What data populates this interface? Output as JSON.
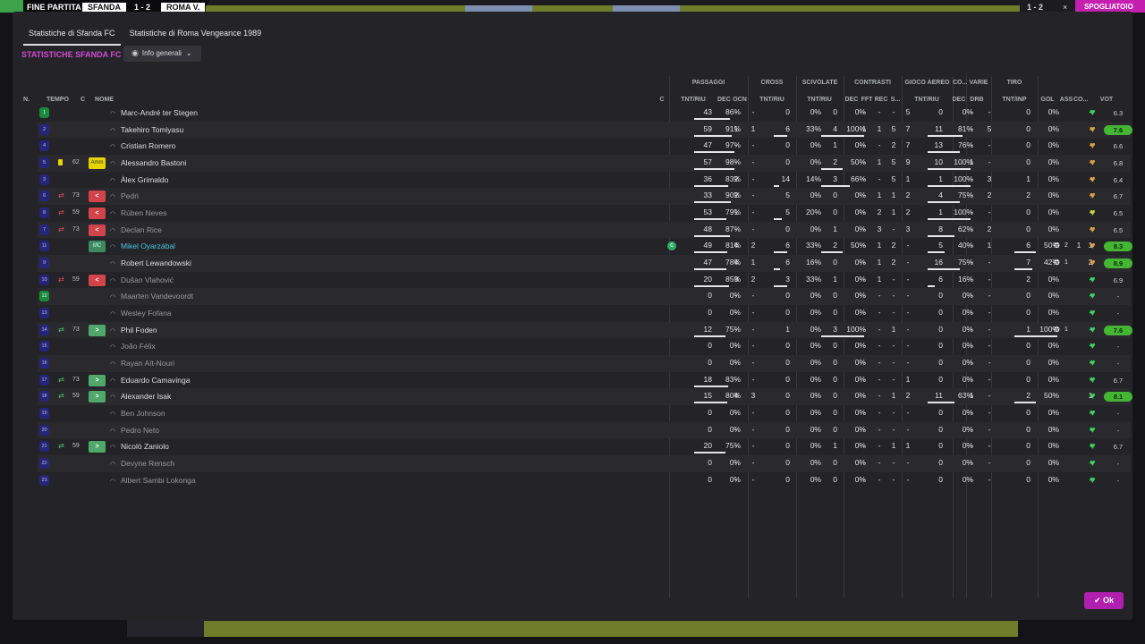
{
  "topbar": {
    "left_label": "FINE PARTITA",
    "home_team": "SFANDA",
    "score": "1 - 2",
    "away_team": "ROMA V.",
    "right_score": "1 - 2",
    "close": "×",
    "action": "SPOGLIATOIO"
  },
  "tabs": [
    {
      "label": "Statistiche di Sfanda FC",
      "active": true
    },
    {
      "label": "Statistiche di Roma Vengeance 1989",
      "active": false
    }
  ],
  "section_title": "STATISTICHE SFANDA FC",
  "filter": {
    "icon": "eye-icon",
    "label": "Info generali"
  },
  "groups": [
    "PASSAGGI",
    "CROSS",
    "SCIVOLATE",
    "CONTRASTI",
    "GIOCO AEREO",
    "CO...",
    "VARIE",
    "TIRO"
  ],
  "columns": {
    "num": "N.",
    "time": "TEMPO",
    "role": "C",
    "name": "NOME",
    "cond": "C",
    "pass_tr": "TNT/RIU",
    "pass_dec": "DEC",
    "pass_ocn": "OCN",
    "cross_tr": "TNT/RIU",
    "tack_tr": "TNT/RIU",
    "con_dec": "DEC",
    "con_fft": "FFT",
    "con_rec": "REC",
    "con_s": "S...",
    "air_tr": "TNT/RIU",
    "co_dec": "DEC",
    "var_drb": "DRB",
    "shot_tr": "TNT/INP",
    "gol": "GOL",
    "ass": "ASS",
    "co2": "CO...",
    "vote": "VOT"
  },
  "players": [
    {
      "num": "1",
      "gk": true,
      "time": "",
      "sub": "",
      "card": "",
      "role_box": "",
      "name": "Marc-André ter Stegen",
      "dim": false,
      "hl": false,
      "icon": "",
      "p": [
        "43",
        "86%",
        0.86
      ],
      "pd": "-",
      "po": "-",
      "c": [
        "0",
        "0%",
        0
      ],
      "s": [
        "0",
        "0%",
        0
      ],
      "cd": "-",
      "cf": "-",
      "cr": "-",
      "cs": "5",
      "a": [
        "0",
        "0%",
        0
      ],
      "kd": "-",
      "dr": "-",
      "t": [
        "0",
        "0%",
        0
      ],
      "gol": "",
      "gi": "",
      "ass": "-",
      "heart": "g",
      "vote": "6.3",
      "vhi": false
    },
    {
      "num": "2",
      "gk": false,
      "time": "",
      "sub": "",
      "card": "",
      "role_box": "",
      "name": "Takehiro Tomiyasu",
      "dim": false,
      "hl": false,
      "icon": "",
      "p": [
        "59",
        "91%",
        0.91
      ],
      "pd": "1",
      "po": "1",
      "c": [
        "6",
        "33%",
        0.33
      ],
      "s": [
        "4",
        "100%",
        1
      ],
      "cd": "1",
      "cf": "1",
      "cr": "5",
      "cs": "7",
      "a": [
        "11",
        "81%",
        0.81
      ],
      "kd": "-",
      "dr": "5",
      "t": [
        "0",
        "0%",
        0
      ],
      "gol": "",
      "gi": "",
      "ass": "-",
      "heart": "o",
      "vote": "7.6",
      "vhi": true
    },
    {
      "num": "4",
      "gk": false,
      "time": "",
      "sub": "",
      "card": "",
      "role_box": "",
      "name": "Cristian Romero",
      "dim": false,
      "hl": false,
      "icon": "",
      "p": [
        "47",
        "97%",
        0.97
      ],
      "pd": "-",
      "po": "-",
      "c": [
        "0",
        "0%",
        0
      ],
      "s": [
        "1",
        "0%",
        0
      ],
      "cd": "-",
      "cf": "-",
      "cr": "2",
      "cs": "7",
      "a": [
        "13",
        "76%",
        0.76
      ],
      "kd": "-",
      "dr": "-",
      "t": [
        "0",
        "0%",
        0
      ],
      "gol": "",
      "gi": "",
      "ass": "-",
      "heart": "o",
      "vote": "6.6",
      "vhi": false
    },
    {
      "num": "5",
      "gk": false,
      "time": "62",
      "sub": "yellow",
      "card": "Amm",
      "role_box": "cap",
      "name": "Alessandro Bastoni",
      "dim": false,
      "hl": false,
      "icon": "",
      "p": [
        "57",
        "98%",
        0.98
      ],
      "pd": "-",
      "po": "-",
      "c": [
        "0",
        "0%",
        0
      ],
      "s": [
        "2",
        "50%",
        0.5
      ],
      "cd": "-",
      "cf": "1",
      "cr": "5",
      "cs": "9",
      "a": [
        "10",
        "100%",
        1
      ],
      "kd": "1",
      "dr": "-",
      "t": [
        "0",
        "0%",
        0
      ],
      "gol": "",
      "gi": "",
      "ass": "-",
      "heart": "o",
      "vote": "6.8",
      "vhi": false
    },
    {
      "num": "3",
      "gk": false,
      "time": "",
      "sub": "",
      "card": "",
      "role_box": "",
      "name": "Àlex Grimaldo",
      "dim": false,
      "hl": false,
      "icon": "",
      "p": [
        "36",
        "83%",
        0.83
      ],
      "pd": "2",
      "po": "-",
      "c": [
        "14",
        "14%",
        0.14
      ],
      "s": [
        "3",
        "66%",
        0.66
      ],
      "cd": "-",
      "cf": "-",
      "cr": "5",
      "cs": "1",
      "a": [
        "1",
        "100%",
        1
      ],
      "kd": "-",
      "dr": "3",
      "t": [
        "1",
        "0%",
        0
      ],
      "gol": "",
      "gi": "",
      "ass": "-",
      "heart": "o",
      "vote": "6.4",
      "vhi": false
    },
    {
      "num": "6",
      "gk": false,
      "time": "73",
      "sub": "out",
      "card": "<",
      "role_box": "out",
      "name": "Pedri",
      "dim": true,
      "hl": false,
      "icon": "",
      "p": [
        "33",
        "90%",
        0.9
      ],
      "pd": "2",
      "po": "-",
      "c": [
        "5",
        "0%",
        0
      ],
      "s": [
        "0",
        "0%",
        0
      ],
      "cd": "-",
      "cf": "1",
      "cr": "1",
      "cs": "2",
      "a": [
        "4",
        "75%",
        0.75
      ],
      "kd": "-",
      "dr": "2",
      "t": [
        "2",
        "0%",
        0
      ],
      "gol": "",
      "gi": "",
      "ass": "-",
      "heart": "o",
      "vote": "6.7",
      "vhi": false
    },
    {
      "num": "8",
      "gk": false,
      "time": "59",
      "sub": "out",
      "card": "<",
      "role_box": "out",
      "name": "Rúben Neves",
      "dim": true,
      "hl": false,
      "icon": "",
      "p": [
        "53",
        "79%",
        0.79
      ],
      "pd": "1",
      "po": "-",
      "c": [
        "5",
        "20%",
        0.2
      ],
      "s": [
        "0",
        "0%",
        0
      ],
      "cd": "-",
      "cf": "2",
      "cr": "1",
      "cs": "2",
      "a": [
        "1",
        "100%",
        1
      ],
      "kd": "-",
      "dr": "-",
      "t": [
        "0",
        "0%",
        0
      ],
      "gol": "",
      "gi": "",
      "ass": "-",
      "heart": "y",
      "vote": "6.5",
      "vhi": false
    },
    {
      "num": "7",
      "gk": false,
      "time": "73",
      "sub": "out",
      "card": "<",
      "role_box": "out",
      "name": "Declan Rice",
      "dim": true,
      "hl": false,
      "icon": "",
      "p": [
        "48",
        "87%",
        0.87
      ],
      "pd": "-",
      "po": "-",
      "c": [
        "0",
        "0%",
        0
      ],
      "s": [
        "1",
        "0%",
        0
      ],
      "cd": "-",
      "cf": "3",
      "cr": "-",
      "cs": "3",
      "a": [
        "8",
        "62%",
        0.62
      ],
      "kd": "-",
      "dr": "2",
      "t": [
        "0",
        "0%",
        0
      ],
      "gol": "",
      "gi": "",
      "ass": "-",
      "heart": "o",
      "vote": "6.5",
      "vhi": false
    },
    {
      "num": "11",
      "gk": false,
      "time": "",
      "sub": "",
      "card": "MC",
      "role_box": "mc",
      "name": "Mikel Oyarzábal",
      "dim": false,
      "hl": true,
      "icon": "c",
      "p": [
        "49",
        "81%",
        0.81
      ],
      "pd": "4",
      "po": "2",
      "c": [
        "6",
        "33%",
        0.33
      ],
      "s": [
        "2",
        "50%",
        0.5
      ],
      "cd": "-",
      "cf": "1",
      "cr": "2",
      "cs": "-",
      "a": [
        "5",
        "40%",
        0.4
      ],
      "kd": "-",
      "dr": "1",
      "t": [
        "6",
        "50%",
        0.5
      ],
      "gol": "1",
      "gi": "2",
      "ass": "1",
      "heart": "o",
      "vote": "8.3",
      "vhi": true
    },
    {
      "num": "9",
      "gk": false,
      "time": "",
      "sub": "",
      "card": "",
      "role_box": "",
      "name": "Robert Lewandowski",
      "dim": false,
      "hl": false,
      "icon": "",
      "p": [
        "47",
        "78%",
        0.78
      ],
      "pd": "4",
      "po": "1",
      "c": [
        "6",
        "16%",
        0.16
      ],
      "s": [
        "0",
        "0%",
        0
      ],
      "cd": "-",
      "cf": "1",
      "cr": "2",
      "cs": "-",
      "a": [
        "16",
        "75%",
        0.75
      ],
      "kd": "-",
      "dr": "-",
      "t": [
        "7",
        "42%",
        0.42
      ],
      "gol": "",
      "gi": "1",
      "ass": "2",
      "heart": "o",
      "vote": "8.9",
      "vhi": true
    },
    {
      "num": "10",
      "gk": false,
      "time": "59",
      "sub": "out",
      "card": "<",
      "role_box": "out",
      "name": "Dušan Vlahović",
      "dim": true,
      "hl": false,
      "icon": "",
      "p": [
        "20",
        "85%",
        0.85
      ],
      "pd": "3",
      "po": "2",
      "c": [
        "3",
        "33%",
        0.33
      ],
      "s": [
        "1",
        "0%",
        0
      ],
      "cd": "-",
      "cf": "1",
      "cr": "-",
      "cs": "-",
      "a": [
        "6",
        "16%",
        0.16
      ],
      "kd": "-",
      "dr": "-",
      "t": [
        "2",
        "0%",
        0
      ],
      "gol": "",
      "gi": "",
      "ass": "-",
      "heart": "g",
      "vote": "6.9",
      "vhi": false
    },
    {
      "num": "12",
      "gk": true,
      "time": "",
      "sub": "",
      "card": "",
      "role_box": "",
      "name": "Maarten Vandevoordt",
      "dim": true,
      "hl": false,
      "icon": "",
      "p": [
        "0",
        "0%",
        0
      ],
      "pd": "-",
      "po": "-",
      "c": [
        "0",
        "0%",
        0
      ],
      "s": [
        "0",
        "0%",
        0
      ],
      "cd": "-",
      "cf": "-",
      "cr": "-",
      "cs": "-",
      "a": [
        "0",
        "0%",
        0
      ],
      "kd": "-",
      "dr": "-",
      "t": [
        "0",
        "0%",
        0
      ],
      "gol": "",
      "gi": "",
      "ass": "-",
      "heart": "g",
      "vote": "-",
      "vhi": false
    },
    {
      "num": "13",
      "gk": false,
      "time": "",
      "sub": "",
      "card": "",
      "role_box": "",
      "name": "Wesley Fofana",
      "dim": true,
      "hl": false,
      "icon": "",
      "p": [
        "0",
        "0%",
        0
      ],
      "pd": "-",
      "po": "-",
      "c": [
        "0",
        "0%",
        0
      ],
      "s": [
        "0",
        "0%",
        0
      ],
      "cd": "-",
      "cf": "-",
      "cr": "-",
      "cs": "-",
      "a": [
        "0",
        "0%",
        0
      ],
      "kd": "-",
      "dr": "-",
      "t": [
        "0",
        "0%",
        0
      ],
      "gol": "",
      "gi": "",
      "ass": "-",
      "heart": "g",
      "vote": "-",
      "vhi": false
    },
    {
      "num": "14",
      "gk": false,
      "time": "73",
      "sub": "in",
      "card": ">",
      "role_box": "in",
      "name": "Phil Foden",
      "dim": false,
      "hl": false,
      "icon": "",
      "p": [
        "12",
        "75%",
        0.75
      ],
      "pd": "-",
      "po": "-",
      "c": [
        "1",
        "0%",
        0
      ],
      "s": [
        "3",
        "100%",
        1
      ],
      "cd": "-",
      "cf": "-",
      "cr": "1",
      "cs": "-",
      "a": [
        "0",
        "0%",
        0
      ],
      "kd": "-",
      "dr": "-",
      "t": [
        "1",
        "100%",
        1
      ],
      "gol": "",
      "gi": "1",
      "ass": "-",
      "heart": "g",
      "vote": "7.6",
      "vhi": true
    },
    {
      "num": "15",
      "gk": false,
      "time": "",
      "sub": "",
      "card": "",
      "role_box": "",
      "name": "João Félix",
      "dim": true,
      "hl": false,
      "icon": "",
      "p": [
        "0",
        "0%",
        0
      ],
      "pd": "-",
      "po": "-",
      "c": [
        "0",
        "0%",
        0
      ],
      "s": [
        "0",
        "0%",
        0
      ],
      "cd": "-",
      "cf": "-",
      "cr": "-",
      "cs": "-",
      "a": [
        "0",
        "0%",
        0
      ],
      "kd": "-",
      "dr": "-",
      "t": [
        "0",
        "0%",
        0
      ],
      "gol": "",
      "gi": "",
      "ass": "-",
      "heart": "g",
      "vote": "-",
      "vhi": false
    },
    {
      "num": "16",
      "gk": false,
      "time": "",
      "sub": "",
      "card": "",
      "role_box": "",
      "name": "Rayan Aït-Nouri",
      "dim": true,
      "hl": false,
      "icon": "",
      "p": [
        "0",
        "0%",
        0
      ],
      "pd": "-",
      "po": "-",
      "c": [
        "0",
        "0%",
        0
      ],
      "s": [
        "0",
        "0%",
        0
      ],
      "cd": "-",
      "cf": "-",
      "cr": "-",
      "cs": "-",
      "a": [
        "0",
        "0%",
        0
      ],
      "kd": "-",
      "dr": "-",
      "t": [
        "0",
        "0%",
        0
      ],
      "gol": "",
      "gi": "",
      "ass": "-",
      "heart": "g",
      "vote": "-",
      "vhi": false
    },
    {
      "num": "17",
      "gk": false,
      "time": "73",
      "sub": "in",
      "card": ">",
      "role_box": "in",
      "name": "Eduardo Camavinga",
      "dim": false,
      "hl": false,
      "icon": "",
      "p": [
        "18",
        "83%",
        0.83
      ],
      "pd": "-",
      "po": "-",
      "c": [
        "0",
        "0%",
        0
      ],
      "s": [
        "0",
        "0%",
        0
      ],
      "cd": "-",
      "cf": "-",
      "cr": "-",
      "cs": "1",
      "a": [
        "0",
        "0%",
        0
      ],
      "kd": "-",
      "dr": "-",
      "t": [
        "0",
        "0%",
        0
      ],
      "gol": "",
      "gi": "",
      "ass": "-",
      "heart": "g",
      "vote": "6.7",
      "vhi": false
    },
    {
      "num": "18",
      "gk": false,
      "time": "59",
      "sub": "in",
      "card": ">",
      "role_box": "in",
      "name": "Alexander Isak",
      "dim": false,
      "hl": false,
      "icon": "",
      "p": [
        "15",
        "80%",
        0.8
      ],
      "pd": "4",
      "po": "3",
      "c": [
        "0",
        "0%",
        0
      ],
      "s": [
        "0",
        "0%",
        0
      ],
      "cd": "-",
      "cf": "-",
      "cr": "1",
      "cs": "2",
      "a": [
        "11",
        "63%",
        0.63
      ],
      "kd": "1",
      "dr": "-",
      "t": [
        "2",
        "50%",
        0.5
      ],
      "gol": "",
      "gi": "",
      "ass": "1",
      "heart": "g",
      "vote": "8.1",
      "vhi": true
    },
    {
      "num": "19",
      "gk": false,
      "time": "",
      "sub": "",
      "card": "",
      "role_box": "",
      "name": "Ben Johnson",
      "dim": true,
      "hl": false,
      "icon": "",
      "p": [
        "0",
        "0%",
        0
      ],
      "pd": "-",
      "po": "-",
      "c": [
        "0",
        "0%",
        0
      ],
      "s": [
        "0",
        "0%",
        0
      ],
      "cd": "-",
      "cf": "-",
      "cr": "-",
      "cs": "-",
      "a": [
        "0",
        "0%",
        0
      ],
      "kd": "-",
      "dr": "-",
      "t": [
        "0",
        "0%",
        0
      ],
      "gol": "",
      "gi": "",
      "ass": "-",
      "heart": "g",
      "vote": "-",
      "vhi": false
    },
    {
      "num": "20",
      "gk": false,
      "time": "",
      "sub": "",
      "card": "",
      "role_box": "",
      "name": "Pedro Neto",
      "dim": true,
      "hl": false,
      "icon": "",
      "p": [
        "0",
        "0%",
        0
      ],
      "pd": "-",
      "po": "-",
      "c": [
        "0",
        "0%",
        0
      ],
      "s": [
        "0",
        "0%",
        0
      ],
      "cd": "-",
      "cf": "-",
      "cr": "-",
      "cs": "-",
      "a": [
        "0",
        "0%",
        0
      ],
      "kd": "-",
      "dr": "-",
      "t": [
        "0",
        "0%",
        0
      ],
      "gol": "",
      "gi": "",
      "ass": "-",
      "heart": "g",
      "vote": "-",
      "vhi": false
    },
    {
      "num": "21",
      "gk": false,
      "time": "59",
      "sub": "in",
      "card": ">",
      "role_box": "in",
      "name": "Nicolò Zaniolo",
      "dim": false,
      "hl": false,
      "icon": "",
      "p": [
        "20",
        "75%",
        0.75
      ],
      "pd": "-",
      "po": "-",
      "c": [
        "0",
        "0%",
        0
      ],
      "s": [
        "1",
        "0%",
        0
      ],
      "cd": "-",
      "cf": "-",
      "cr": "1",
      "cs": "1",
      "a": [
        "0",
        "0%",
        0
      ],
      "kd": "-",
      "dr": "-",
      "t": [
        "0",
        "0%",
        0
      ],
      "gol": "",
      "gi": "",
      "ass": "-",
      "heart": "g",
      "vote": "6.7",
      "vhi": false
    },
    {
      "num": "22",
      "gk": false,
      "time": "",
      "sub": "",
      "card": "",
      "role_box": "",
      "name": "Devyne Rensch",
      "dim": true,
      "hl": false,
      "icon": "",
      "p": [
        "0",
        "0%",
        0
      ],
      "pd": "-",
      "po": "-",
      "c": [
        "0",
        "0%",
        0
      ],
      "s": [
        "0",
        "0%",
        0
      ],
      "cd": "-",
      "cf": "-",
      "cr": "-",
      "cs": "-",
      "a": [
        "0",
        "0%",
        0
      ],
      "kd": "-",
      "dr": "-",
      "t": [
        "0",
        "0%",
        0
      ],
      "gol": "",
      "gi": "",
      "ass": "-",
      "heart": "g",
      "vote": "-",
      "vhi": false
    },
    {
      "num": "23",
      "gk": false,
      "time": "",
      "sub": "",
      "card": "",
      "role_box": "",
      "name": "Albert Sambi Lokonga",
      "dim": true,
      "hl": false,
      "icon": "",
      "p": [
        "0",
        "0%",
        0
      ],
      "pd": "-",
      "po": "-",
      "c": [
        "0",
        "0%",
        0
      ],
      "s": [
        "0",
        "0%",
        0
      ],
      "cd": "-",
      "cf": "-",
      "cr": "-",
      "cs": "-",
      "a": [
        "0",
        "0%",
        0
      ],
      "kd": "-",
      "dr": "-",
      "t": [
        "0",
        "0%",
        0
      ],
      "gol": "",
      "gi": "",
      "ass": "-",
      "heart": "g",
      "vote": "-",
      "vhi": false
    }
  ],
  "ok_button": {
    "label": "Ok",
    "icon": "check-icon"
  },
  "colors": {
    "accent": "#c51fb0",
    "section_title": "#d24ad4",
    "vote_high": "#45b634"
  }
}
